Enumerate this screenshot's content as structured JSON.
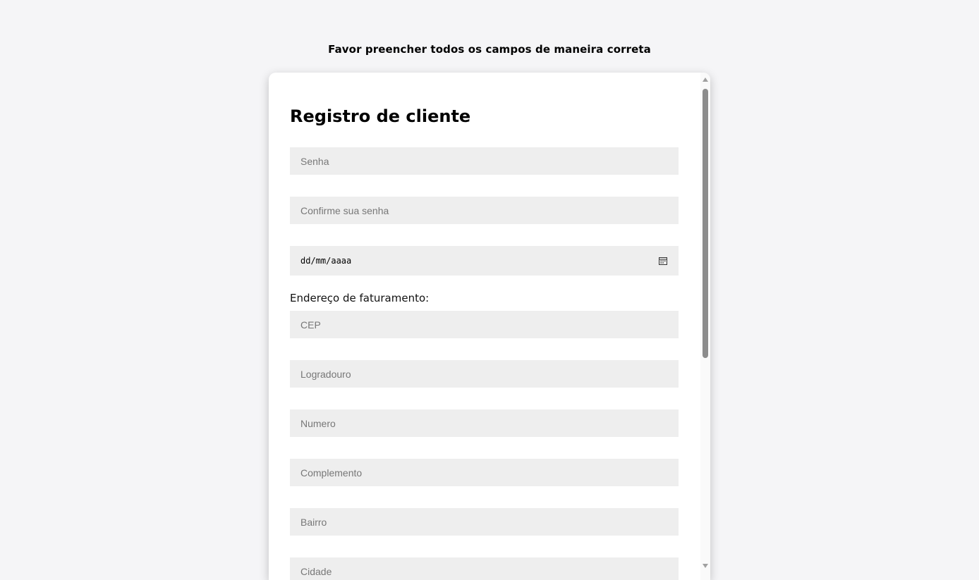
{
  "page": {
    "heading": "Favor preencher todos os campos de maneira correta"
  },
  "form": {
    "title": "Registro de cliente",
    "fields": {
      "senha": {
        "placeholder": "Senha",
        "value": ""
      },
      "confirme_senha": {
        "placeholder": "Confirme sua senha",
        "value": ""
      },
      "data_nascimento": {
        "display": "dd/mm/aaaa",
        "icon": "calendar-icon"
      },
      "cep": {
        "placeholder": "CEP",
        "value": ""
      },
      "logradouro": {
        "placeholder": "Logradouro",
        "value": ""
      },
      "numero": {
        "placeholder": "Numero",
        "value": ""
      },
      "complemento": {
        "placeholder": "Complemento",
        "value": ""
      },
      "bairro": {
        "placeholder": "Bairro",
        "value": ""
      },
      "cidade": {
        "placeholder": "Cidade",
        "value": ""
      }
    },
    "billing_section_label": "Endereço de faturamento:"
  },
  "colors": {
    "background": "#f5f5f7",
    "card": "#ffffff",
    "field_background": "#eeeeee",
    "scroll_thumb": "#8c8c8c"
  }
}
